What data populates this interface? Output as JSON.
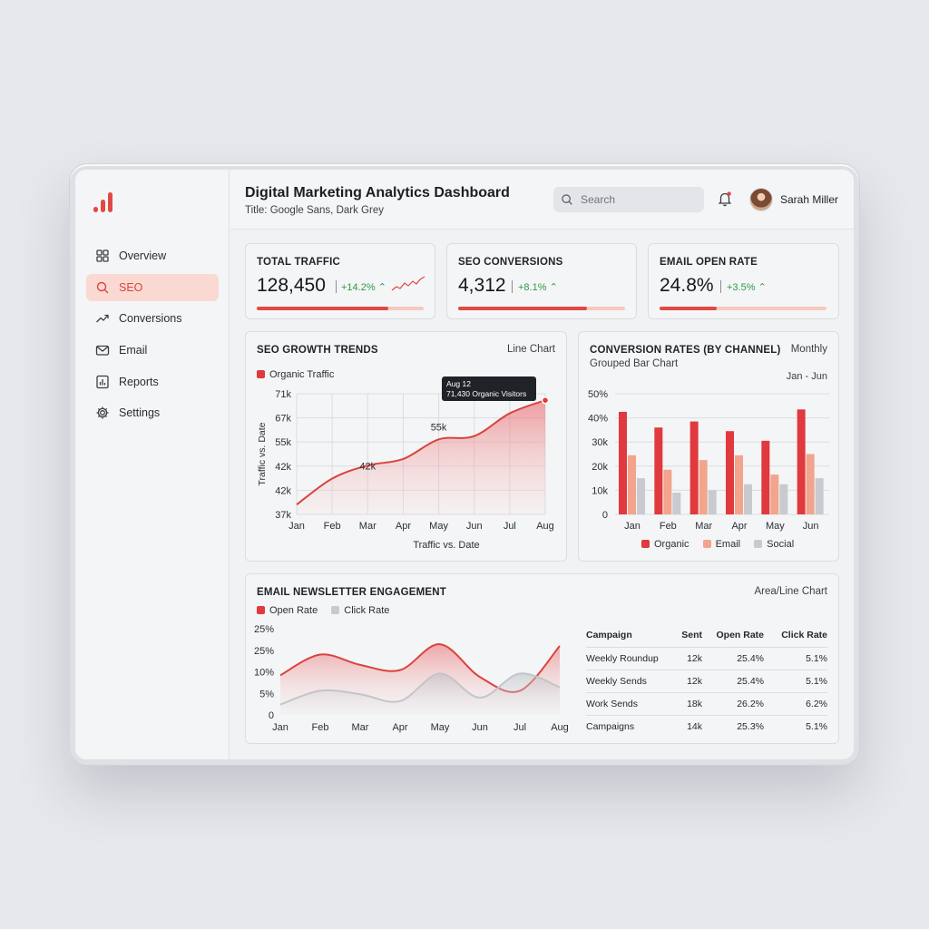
{
  "header": {
    "title": "Digital Marketing Analytics Dashboard",
    "subtitle": "Title: Google Sans, Dark Grey",
    "search_placeholder": "Search",
    "user_name": "Sarah Miller"
  },
  "sidebar": {
    "items": [
      {
        "label": "Overview",
        "icon": "grid-icon"
      },
      {
        "label": "SEO",
        "icon": "search-icon",
        "active": true
      },
      {
        "label": "Conversions",
        "icon": "trend-icon"
      },
      {
        "label": "Email",
        "icon": "mail-icon"
      },
      {
        "label": "Reports",
        "icon": "report-icon"
      },
      {
        "label": "Settings",
        "icon": "gear-icon"
      }
    ]
  },
  "kpis": [
    {
      "label": "TOTAL TRAFFIC",
      "value": "128,450",
      "delta": "+14.2%",
      "progress": 0.79
    },
    {
      "label": "SEO CONVERSIONS",
      "value": "4,312",
      "delta": "+8.1%",
      "progress": 0.77
    },
    {
      "label": "EMAIL OPEN RATE",
      "value": "24.8%",
      "delta": "+3.5%",
      "progress": 0.34
    }
  ],
  "colors": {
    "accent": "#df4a45",
    "organic": "#e0393e",
    "email": "#f2a48c",
    "social": "#c8cacf",
    "positive": "#2f9a45"
  },
  "seo_card": {
    "title": "SEO GROWTH TRENDS",
    "chart_kind": "Line Chart",
    "tooltip_date": "Aug 12",
    "tooltip_value": "71,430 Organic Visitors"
  },
  "conv_card": {
    "title": "CONVERSION RATES (BY CHANNEL)",
    "subtitle": "Grouped Bar Chart",
    "period": "Monthly",
    "range": "Jan - Jun"
  },
  "email_card": {
    "title": "EMAIL NEWSLETTER ENGAGEMENT",
    "chart_kind": "Area/Line Chart",
    "table": {
      "headers": [
        "Campaign",
        "Sent",
        "Open Rate",
        "Click Rate"
      ],
      "rows": [
        [
          "Weekly Roundup",
          "12k",
          "25.4%",
          "5.1%"
        ],
        [
          "Weekly Sends",
          "12k",
          "25.4%",
          "5.1%"
        ],
        [
          "Work Sends",
          "18k",
          "26.2%",
          "6.2%"
        ],
        [
          "Campaigns",
          "14k",
          "25.3%",
          "5.1%"
        ]
      ]
    }
  },
  "chart_data": [
    {
      "type": "area",
      "title": "",
      "xlabel": "Traffic vs. Date",
      "ylabel": "Traffic vs. Date",
      "categories": [
        "Jan",
        "Feb",
        "Mar",
        "Apr",
        "May",
        "Jun",
        "Jul",
        "Aug"
      ],
      "y_tick_labels": [
        "71k",
        "67k",
        "55k",
        "42k",
        "42k",
        "37k"
      ],
      "series": [
        {
          "name": "Organic Traffic",
          "values": [
            38,
            46,
            50,
            52,
            58,
            59,
            66,
            70
          ]
        }
      ],
      "annotations": [
        {
          "x": "Mar",
          "y": 46,
          "label": "42k"
        },
        {
          "x": "May",
          "y": 58,
          "label": "55k"
        }
      ],
      "ylim": [
        35,
        72
      ],
      "grid": true,
      "legend": "top-left"
    },
    {
      "type": "bar",
      "categories": [
        "Jan",
        "Feb",
        "Mar",
        "Apr",
        "May",
        "Jun"
      ],
      "y_tick_labels": [
        "50%",
        "40%",
        "30k",
        "20k",
        "10k",
        "0"
      ],
      "series": [
        {
          "name": "Organic",
          "values": [
            42.5,
            36,
            38.5,
            34.5,
            30.5,
            43.5
          ]
        },
        {
          "name": "Email",
          "values": [
            24.5,
            18.5,
            22.5,
            24.5,
            16.5,
            25
          ]
        },
        {
          "name": "Social",
          "values": [
            15,
            9,
            10,
            12.5,
            12.5,
            15
          ]
        }
      ],
      "ylim": [
        0,
        50
      ],
      "grid": true,
      "legend": "bottom"
    },
    {
      "type": "area",
      "categories": [
        "Jan",
        "Feb",
        "Mar",
        "Apr",
        "May",
        "Jun",
        "Jul",
        "Aug"
      ],
      "y_tick_labels": [
        "25%",
        "25%",
        "10%",
        "5%",
        "0"
      ],
      "series": [
        {
          "name": "Open Rate",
          "values": [
            11.5,
            17.5,
            14.5,
            13,
            20.5,
            11,
            7,
            20
          ]
        },
        {
          "name": "Click Rate",
          "values": [
            3,
            7,
            6,
            4,
            12,
            5,
            12,
            8
          ]
        }
      ],
      "ylim": [
        0,
        25
      ],
      "grid": false,
      "legend": "top-left"
    }
  ]
}
